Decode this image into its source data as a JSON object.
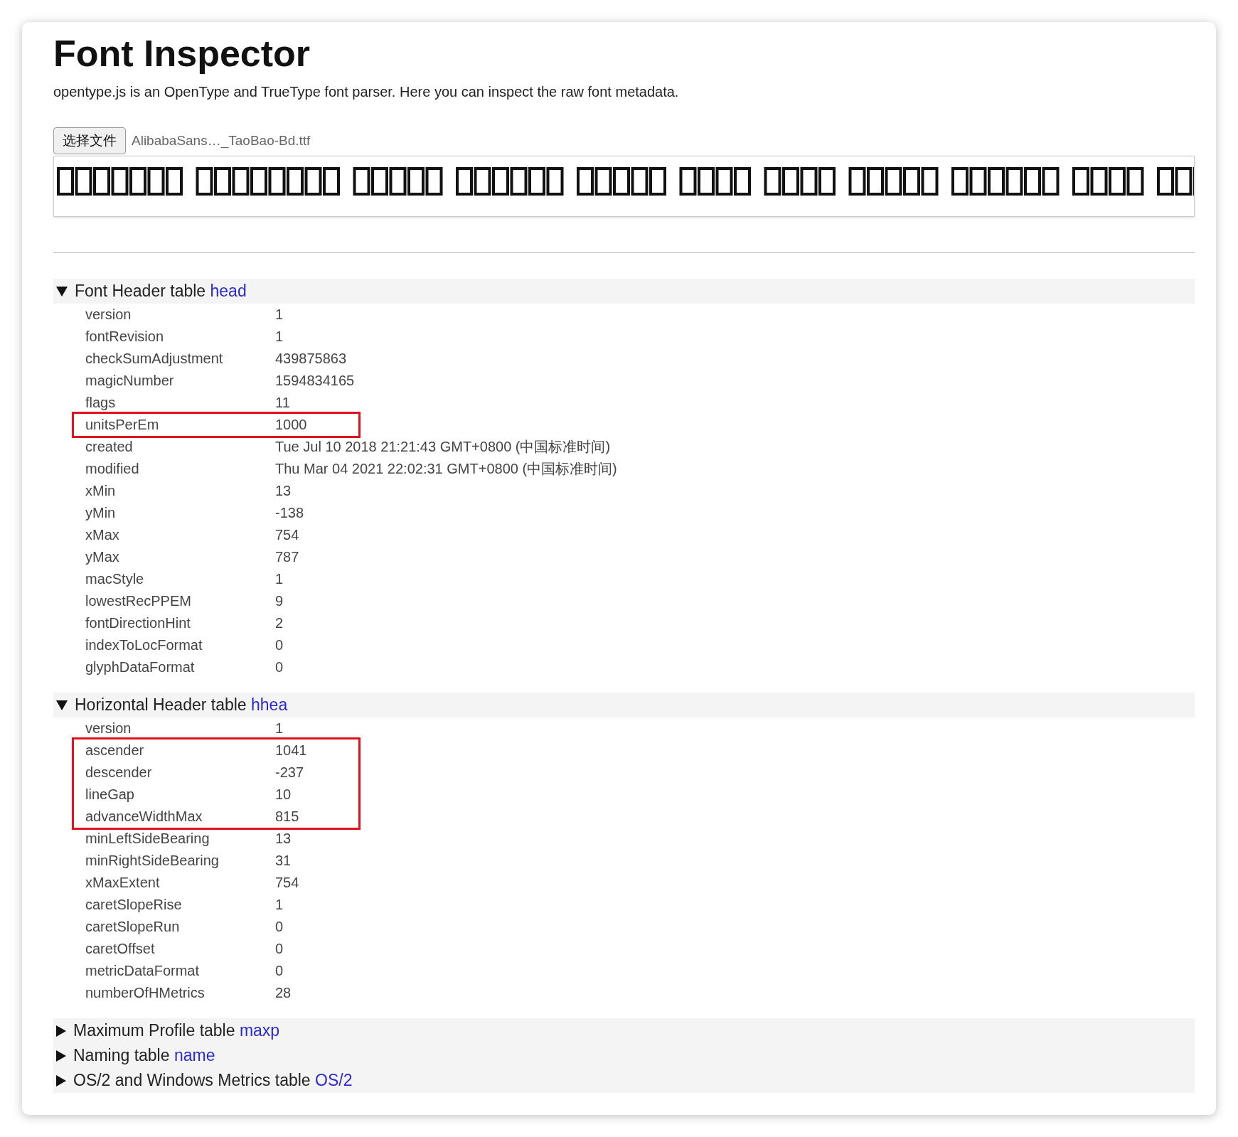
{
  "title": "Font Inspector",
  "description": "opentype.js is an OpenType and TrueType font parser. Here you can inspect the raw font metadata.",
  "file_button": "选择文件",
  "file_name": "AlibabaSans…_TaoBao-Bd.ttf",
  "sections": [
    {
      "label": "Font Header table",
      "tag": "head",
      "expanded": true,
      "rows": [
        {
          "key": "version",
          "value": "1",
          "highlighted": false
        },
        {
          "key": "fontRevision",
          "value": "1",
          "highlighted": false
        },
        {
          "key": "checkSumAdjustment",
          "value": "439875863",
          "highlighted": false
        },
        {
          "key": "magicNumber",
          "value": "1594834165",
          "highlighted": false
        },
        {
          "key": "flags",
          "value": "11",
          "highlighted": false
        },
        {
          "key": "unitsPerEm",
          "value": "1000",
          "highlighted": true
        },
        {
          "key": "created",
          "value": "Tue Jul 10 2018 21:21:43 GMT+0800 (中国标准时间)",
          "highlighted": false
        },
        {
          "key": "modified",
          "value": "Thu Mar 04 2021 22:02:31 GMT+0800 (中国标准时间)",
          "highlighted": false
        },
        {
          "key": "xMin",
          "value": "13",
          "highlighted": false
        },
        {
          "key": "yMin",
          "value": "-138",
          "highlighted": false
        },
        {
          "key": "xMax",
          "value": "754",
          "highlighted": false
        },
        {
          "key": "yMax",
          "value": "787",
          "highlighted": false
        },
        {
          "key": "macStyle",
          "value": "1",
          "highlighted": false
        },
        {
          "key": "lowestRecPPEM",
          "value": "9",
          "highlighted": false
        },
        {
          "key": "fontDirectionHint",
          "value": "2",
          "highlighted": false
        },
        {
          "key": "indexToLocFormat",
          "value": "0",
          "highlighted": false
        },
        {
          "key": "glyphDataFormat",
          "value": "0",
          "highlighted": false
        }
      ]
    },
    {
      "label": "Horizontal Header table",
      "tag": "hhea",
      "expanded": true,
      "rows": [
        {
          "key": "version",
          "value": "1",
          "highlighted": false
        },
        {
          "key": "ascender",
          "value": "1041",
          "highlighted": true
        },
        {
          "key": "descender",
          "value": "-237",
          "highlighted": true
        },
        {
          "key": "lineGap",
          "value": "10",
          "highlighted": true
        },
        {
          "key": "advanceWidthMax",
          "value": "815",
          "highlighted": true
        },
        {
          "key": "minLeftSideBearing",
          "value": "13",
          "highlighted": false
        },
        {
          "key": "minRightSideBearing",
          "value": "31",
          "highlighted": false
        },
        {
          "key": "xMaxExtent",
          "value": "754",
          "highlighted": false
        },
        {
          "key": "caretSlopeRise",
          "value": "1",
          "highlighted": false
        },
        {
          "key": "caretSlopeRun",
          "value": "0",
          "highlighted": false
        },
        {
          "key": "caretOffset",
          "value": "0",
          "highlighted": false
        },
        {
          "key": "metricDataFormat",
          "value": "0",
          "highlighted": false
        },
        {
          "key": "numberOfHMetrics",
          "value": "28",
          "highlighted": false
        }
      ]
    },
    {
      "label": "Maximum Profile table",
      "tag": "maxp",
      "expanded": false
    },
    {
      "label": "Naming table",
      "tag": "name",
      "expanded": false
    },
    {
      "label": "OS/2 and Windows Metrics table",
      "tag": "OS/2",
      "expanded": false
    }
  ]
}
